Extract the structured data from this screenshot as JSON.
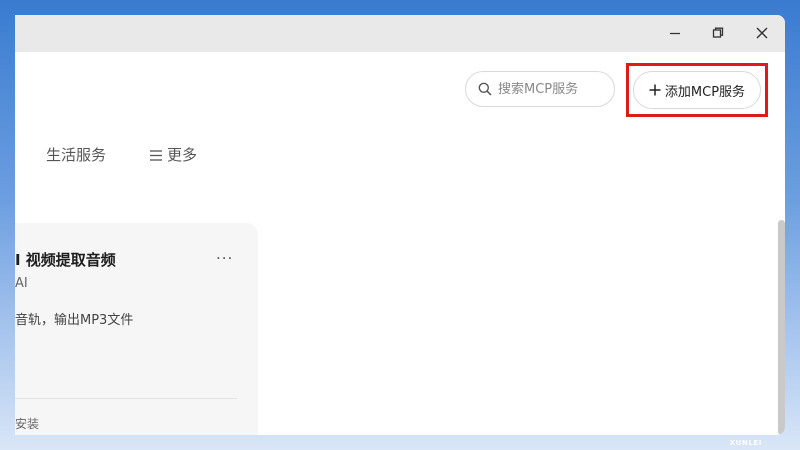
{
  "window": {
    "controls": {
      "minimize_icon": "minimize-icon",
      "restore_icon": "restore-icon",
      "close_icon": "close-icon"
    }
  },
  "header": {
    "search": {
      "placeholder": "搜索MCP服务",
      "value": "",
      "icon": "search-icon"
    },
    "add_button": {
      "label": "添加MCP服务",
      "icon": "plus-icon"
    },
    "highlight_color": "#e01919"
  },
  "tabs": [
    {
      "label": "生活服务"
    },
    {
      "label": "更多",
      "icon": "menu-icon"
    }
  ],
  "cards": [
    {
      "title": "I 视频提取音频",
      "author": "AI",
      "description": "音轨，输出MP3文件",
      "footer": "安装",
      "menu": "..."
    }
  ],
  "desktop": {
    "watermark": "XUNLEI"
  }
}
